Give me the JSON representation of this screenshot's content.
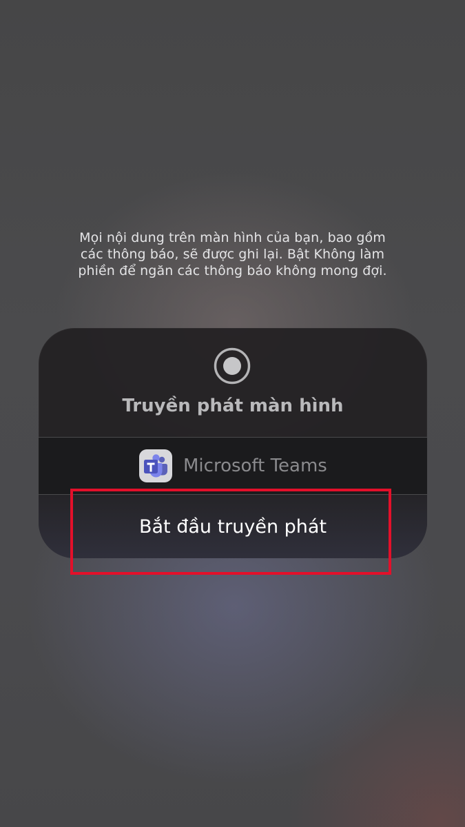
{
  "warning": {
    "line1": "Mọi nội dung trên màn hình của bạn, bao gồm",
    "line2": "các thông báo, sẽ được ghi lại. Bật Không làm",
    "line3": "phiền để ngăn các thông báo không mong đợi."
  },
  "sheet": {
    "record_icon": "record-icon",
    "title": "Truyền phát màn hình",
    "app": {
      "icon": "microsoft-teams-icon",
      "name": "Microsoft Teams"
    },
    "start_label": "Bắt đầu truyền phát"
  },
  "colors": {
    "highlight": "#e3102a",
    "sheet_bg": "#222022",
    "teams_purple": "#5059c9"
  }
}
